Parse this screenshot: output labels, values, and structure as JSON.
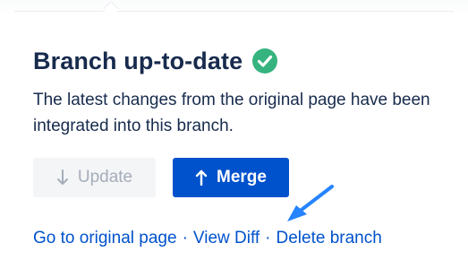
{
  "panel": {
    "title": "Branch up-to-date",
    "title_icon": "check-circle-icon",
    "description": "The latest changes from the original page have been integrated into this branch."
  },
  "buttons": {
    "update": {
      "label": "Update",
      "icon": "arrow-down-icon",
      "disabled": true
    },
    "merge": {
      "label": "Merge",
      "icon": "arrow-up-icon"
    }
  },
  "links": {
    "original_page": "Go to original page",
    "view_diff": "View Diff",
    "delete_branch": "Delete branch",
    "separator": "·"
  },
  "annotation": {
    "icon": "pointer-arrow-icon",
    "color": "#2684ff"
  },
  "colors": {
    "heading": "#172b4d",
    "success": "#36b37e",
    "primary": "#0052cc",
    "disabled_bg": "#f4f5f7",
    "disabled_text": "#a5adba"
  }
}
